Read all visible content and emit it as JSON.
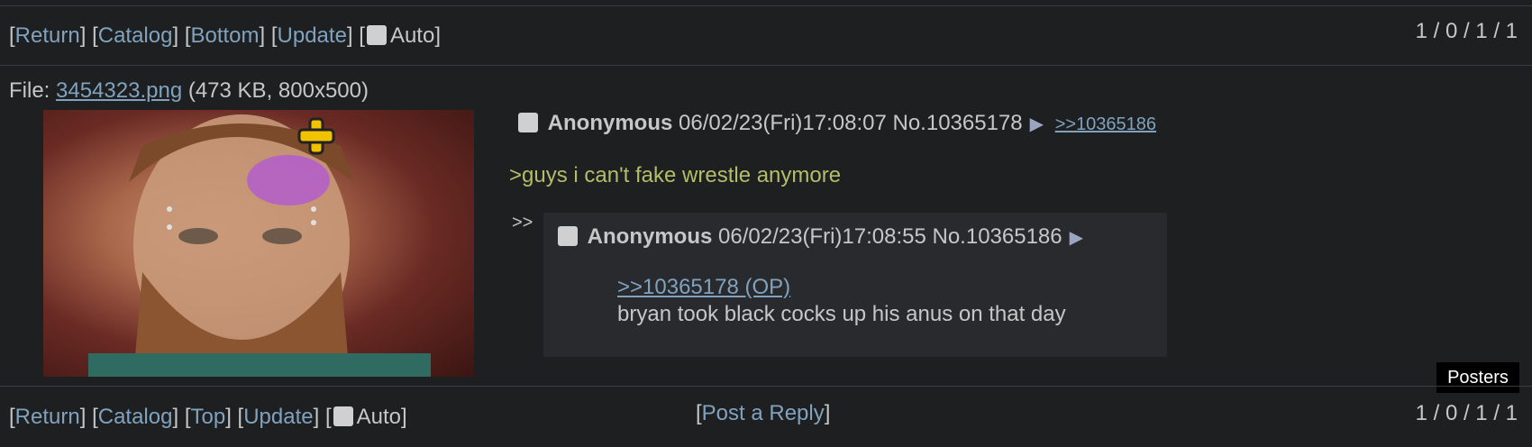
{
  "top_nav": {
    "return": "Return",
    "catalog": "Catalog",
    "bottom": "Bottom",
    "update": "Update",
    "auto": "Auto",
    "stats": "1 / 0 / 1 / 1"
  },
  "op": {
    "file_label": "File:",
    "file_name": "3454323.png",
    "file_meta": "(473 KB, 800x500)",
    "name": "Anonymous",
    "datetime": "06/02/23(Fri)17:08:07",
    "post_no": "No.10365178",
    "backlink": ">>10365186",
    "comment": ">guys i can't fake wrestle anymore"
  },
  "reply": {
    "marker": ">>",
    "name": "Anonymous",
    "datetime": "06/02/23(Fri)17:08:55",
    "post_no": "No.10365186",
    "quotelink": ">>10365178 (OP)",
    "comment": "bryan took black cocks up his anus on that day"
  },
  "posters_button": "Posters",
  "bottom_nav": {
    "return": "Return",
    "catalog": "Catalog",
    "top": "Top",
    "update": "Update",
    "auto": "Auto",
    "post_reply": "Post a Reply",
    "stats": "1 / 0 / 1 / 1"
  },
  "icons": {
    "post_arrow": "play-triangle-icon",
    "checkbox": "checkbox-icon"
  },
  "colors": {
    "background": "#1d1f21",
    "link": "#81a2be",
    "greentext": "#b5bd68",
    "reply_bg": "#282a2e"
  }
}
